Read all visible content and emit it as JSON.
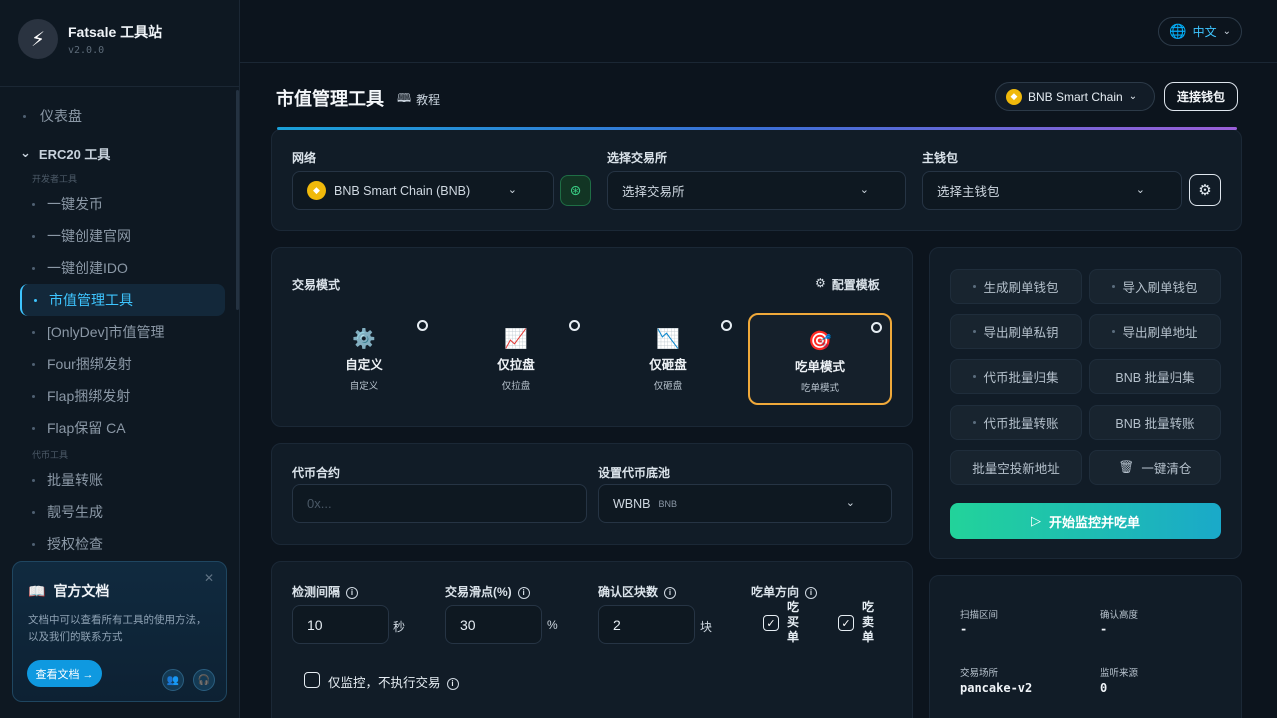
{
  "brand": {
    "name": "Fatsale 工具站",
    "version": "v2.0.0",
    "logo_icon": "lightning-icon"
  },
  "topbar": {
    "language": "中文"
  },
  "sidebar": {
    "dashboard": "仪表盘",
    "group": "ERC20 工具",
    "sub_dev": "开发者工具",
    "dev_items": [
      "一键发币",
      "一键创建官网",
      "一键创建IDO",
      "市值管理工具",
      "[OnlyDev]市值管理",
      "Four捆绑发射",
      "Flap捆绑发射",
      "Flap保留 CA"
    ],
    "sub_token": "代币工具",
    "token_items": [
      "批量转账",
      "靓号生成",
      "授权检查"
    ],
    "active": "市值管理工具"
  },
  "doc_card": {
    "title": "官方文档",
    "text": "文档中可以查看所有工具的使用方法，以及我们的联系方式",
    "button": "查看文档 →"
  },
  "header": {
    "title": "市值管理工具",
    "tutorial": "教程",
    "chain": "BNB Smart Chain",
    "connect": "连接钱包"
  },
  "network_card": {
    "network_label": "网络",
    "network_value": "BNB Smart Chain (BNB)",
    "exchange_label": "选择交易所",
    "exchange_placeholder": "选择交易所",
    "wallet_label": "主钱包",
    "wallet_placeholder": "选择主钱包"
  },
  "mode_card": {
    "label": "交易模式",
    "config": "配置模板",
    "modes": [
      {
        "name": "自定义",
        "sub": "自定义",
        "icon": "⚙️",
        "selected": false
      },
      {
        "name": "仅拉盘",
        "sub": "仅拉盘",
        "icon": "📈",
        "selected": false
      },
      {
        "name": "仅砸盘",
        "sub": "仅砸盘",
        "icon": "📉",
        "selected": false
      },
      {
        "name": "吃单模式",
        "sub": "吃单模式",
        "icon": "🎯",
        "selected": true
      }
    ]
  },
  "actions": {
    "buttons": [
      "生成刷单钱包",
      "导入刷单钱包",
      "导出刷单私钥",
      "导出刷单地址",
      "代币批量归集",
      "BNB 批量归集",
      "代币批量转账",
      "BNB 批量转账",
      "批量空投新地址",
      "一键清仓"
    ],
    "start": "开始监控并吃单"
  },
  "token_card": {
    "contract_label": "代币合约",
    "contract_placeholder": "0x...",
    "pool_label": "设置代币底池",
    "pool_value": "WBNB",
    "pool_sub": "BNB"
  },
  "settings": {
    "interval_label": "检测间隔",
    "interval_value": "10",
    "interval_unit": "秒",
    "slippage_label": "交易滑点(%)",
    "slippage_value": "30",
    "slippage_unit": "%",
    "confirm_label": "确认区块数",
    "confirm_value": "2",
    "confirm_unit": "块",
    "direction_label": "吃单方向",
    "buy": "吃买单",
    "sell": "吃卖单",
    "monitor_only": "仅监控，不执行交易"
  },
  "stats": {
    "scan_label": "扫描区间",
    "scan_value": "-",
    "height_label": "确认高度",
    "height_value": "-",
    "venue_label": "交易场所",
    "venue_value": "pancake-v2",
    "source_label": "监听来源",
    "source_value": "0"
  },
  "colors": {
    "accent": "#3ec5ff",
    "selected_border": "#f0a93a",
    "bnb": "#f0b90b"
  }
}
